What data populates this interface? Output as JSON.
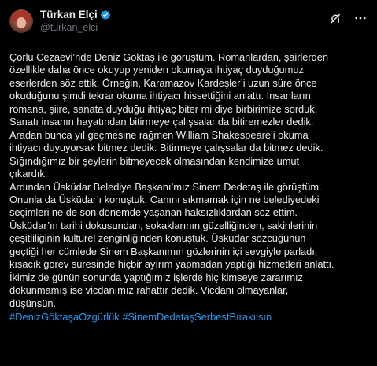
{
  "user": {
    "display_name": "Türkan Elçi",
    "handle": "@turkan_elci",
    "verified_color": "#1d9bf0"
  },
  "icons": {
    "verified": "verified-badge-icon",
    "grok": "grok-icon",
    "more": "more-options-icon"
  },
  "tweet": {
    "text": "Çorlu Cezaevi’nde Deniz Göktaş ile görüştüm. Romanlardan, şairlerden\nözellikle daha önce okuyup yeniden okumaya ihtiyaç duyduğumuz\neserlerden söz ettik. Örneğin, Karamazov Kardeşler’i uzun süre önce\nokuduğunu şimdi tekrar okuma ihtiyacı hissettiğini anlattı. İnsanların\nromana, şiire, sanata duyduğu ihtiyaç biter mi diye birbirimize sorduk.\nSanatı insanın hayatından bitirmeye çalışsalar da bitiremezler dedik.\nAradan bunca yıl geçmesine rağmen William Shakespeare’i okuma\nihtiyacı duyuyorsak bitmez dedik. Bitirmeye çalışsalar da bitmez dedik.\nSığındığımız bir şeylerin bitmeyecek olmasından  kendimize umut\nçıkardık.\nArdından Üsküdar Belediye Başkanı’mız Sinem Dedetaş ile görüştüm.\nOnunla da Üsküdar’ı konuştuk. Canını sıkmamak için ne belediyedeki\nseçimleri ne de son dönemde yaşanan haksızlıklardan söz ettim.\nÜsküdar’ın tarihi  dokusundan, sokaklarının güzelliğinden, sakinlerinin\nçeşitliliğinin kültürel zenginliğinden konuştuk. Üsküdar sözcüğünün\ngeçtiği her cümlede Sinem Başkanımın gözlerinin içi sevgiyle parladı,\nkısacık görev süresinde hiçbir ayırım yapmadan yaptığı hizmetleri anlattı.\nİkimiz de günün sonunda yaptığımız işlerde  hiç kimseye zararımız\ndokunmamış ise vicdanımız rahattır dedik. Vicdanı olmayanlar,\ndüşünsün.",
    "hashtags": [
      "#DenizGöktaşaÖzgürlük",
      "#SinemDedetaşSerbestBırakılsın"
    ],
    "hashtag_color": "#1d9bf0"
  }
}
